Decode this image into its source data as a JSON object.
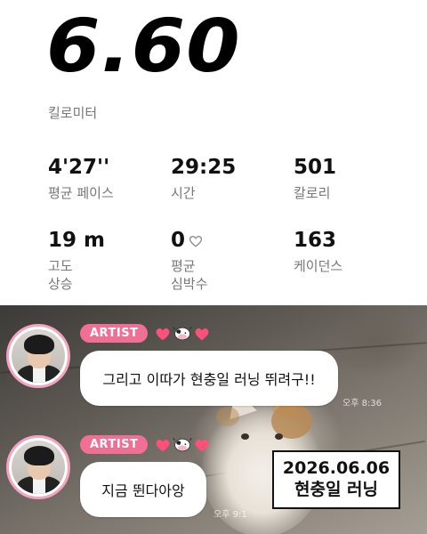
{
  "run_summary": {
    "distance": "6.60",
    "distance_unit": "킬로미터",
    "metrics": [
      {
        "value": "4'27''",
        "label": "평균 페이스"
      },
      {
        "value": "29:25",
        "label": "시간"
      },
      {
        "value": "501",
        "label": "칼로리"
      },
      {
        "value": "19 m",
        "label_line1": "고도",
        "label_line2": "상승"
      },
      {
        "value": "0",
        "label_line1": "평균",
        "label_line2": "심박수",
        "icon": "heart-outline-icon"
      },
      {
        "value": "163",
        "label": "케이던스"
      }
    ]
  },
  "chat": {
    "messages": [
      {
        "badge": "ARTIST",
        "text": "그리고 이따가 현충일 러닝 뛰려구!!",
        "time": "오후 8:36"
      },
      {
        "badge": "ARTIST",
        "text": "지금 뛴다아앙",
        "time": "오후 9:1"
      }
    ],
    "emoji_icons": [
      "pink-heart-icon",
      "cow-face-icon",
      "pink-heart-icon"
    ]
  },
  "caption": {
    "date": "2026.06.06",
    "title": "현충일 러닝"
  },
  "colors": {
    "badge_pink": "#f06f95",
    "avatar_ring": "#f4a3c1",
    "heart_pink": "#ff4f7b"
  }
}
